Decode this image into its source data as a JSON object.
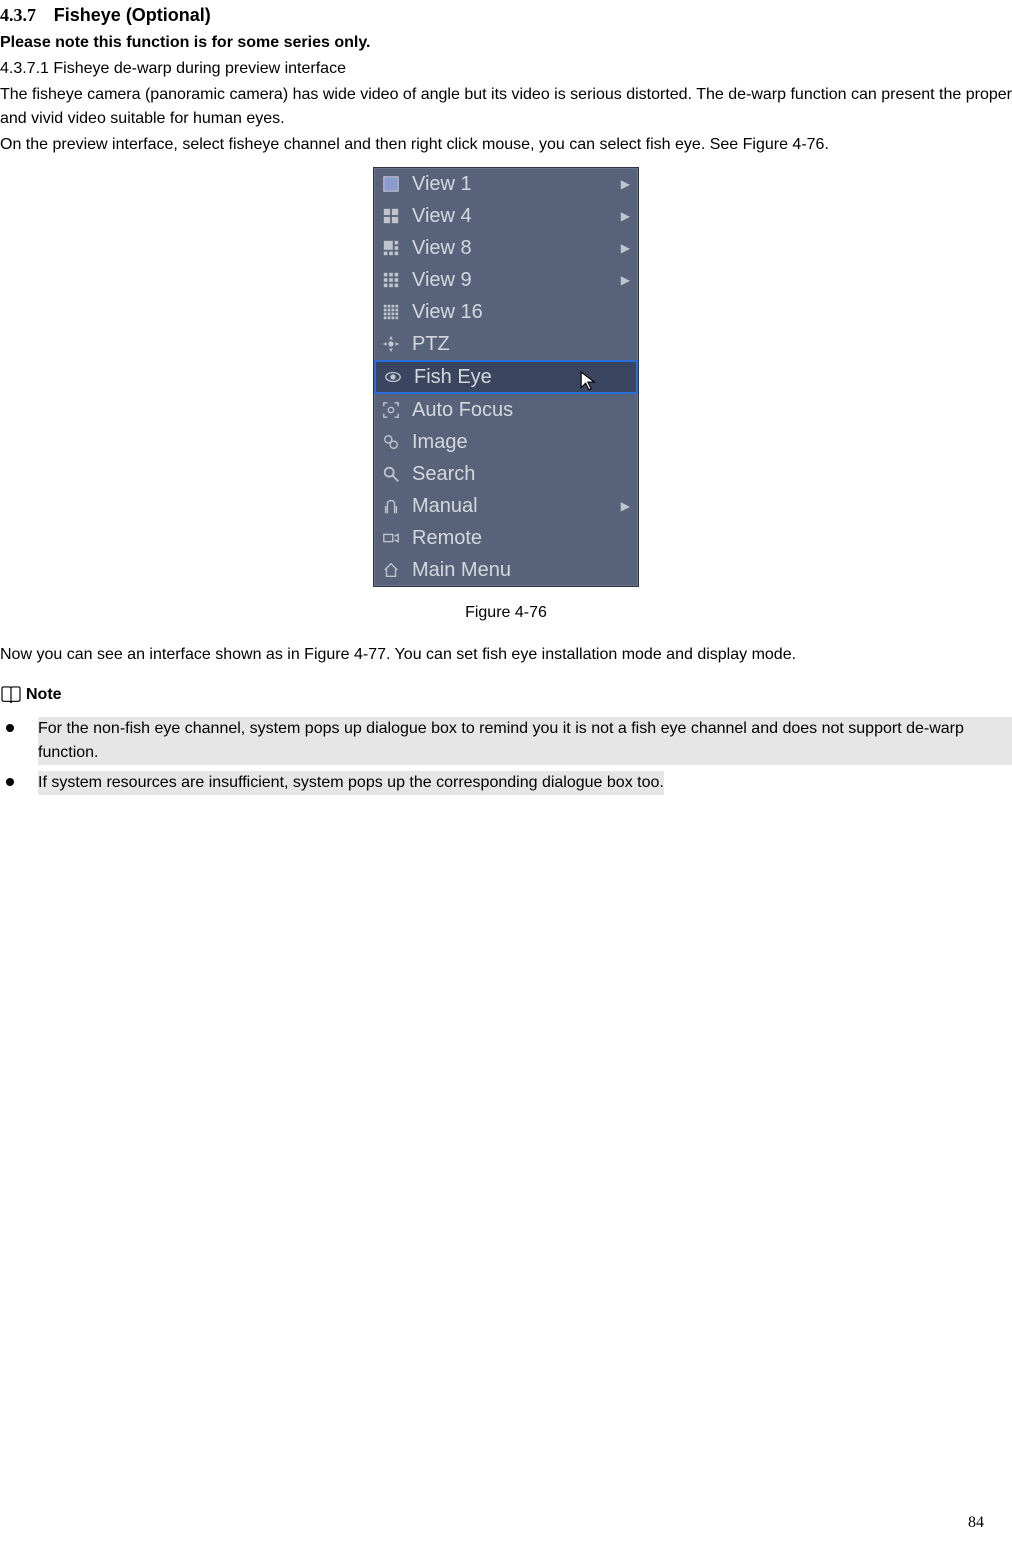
{
  "section": {
    "number": "4.3.7",
    "title": "Fisheye (Optional)"
  },
  "subnote": "Please note this function is for some series only.",
  "subsection": "4.3.7.1 Fisheye de-warp during preview interface",
  "para1": "The fisheye camera (panoramic camera) has wide video of angle but its video is serious distorted. The de-warp function can present the proper and vivid video suitable for human eyes.",
  "para2": "On the preview interface, select fisheye channel and then right click mouse, you can select fish eye. See Figure 4-76.",
  "menu": {
    "items": [
      {
        "icon": "view1-icon",
        "label": "View 1",
        "arrow": true
      },
      {
        "icon": "view4-icon",
        "label": "View 4",
        "arrow": true
      },
      {
        "icon": "view8-icon",
        "label": "View 8",
        "arrow": true
      },
      {
        "icon": "view9-icon",
        "label": "View 9",
        "arrow": true
      },
      {
        "icon": "view16-icon",
        "label": "View 16",
        "arrow": false
      },
      {
        "icon": "ptz-icon",
        "label": "PTZ",
        "arrow": false
      },
      {
        "icon": "fisheye-icon",
        "label": "Fish Eye",
        "arrow": false,
        "highlighted": true
      },
      {
        "icon": "autofocus-icon",
        "label": "Auto Focus",
        "arrow": false
      },
      {
        "icon": "image-icon",
        "label": "Image",
        "arrow": false
      },
      {
        "icon": "search-icon",
        "label": "Search",
        "arrow": false
      },
      {
        "icon": "manual-icon",
        "label": "Manual",
        "arrow": true
      },
      {
        "icon": "remote-icon",
        "label": "Remote",
        "arrow": false
      },
      {
        "icon": "mainmenu-icon",
        "label": "Main Menu",
        "arrow": false
      }
    ]
  },
  "figure_caption": "Figure 4-76",
  "para3": "Now you can see an interface shown as in Figure 4-77. You can set fish eye installation mode and display mode.",
  "note_label": "Note",
  "bullets": [
    "For the non-fish eye channel, system pops up dialogue box to remind you it is not a fish eye channel and does not support de-warp function.",
    "If system resources are insufficient, system pops up the corresponding dialogue box too."
  ],
  "page_number": "84"
}
